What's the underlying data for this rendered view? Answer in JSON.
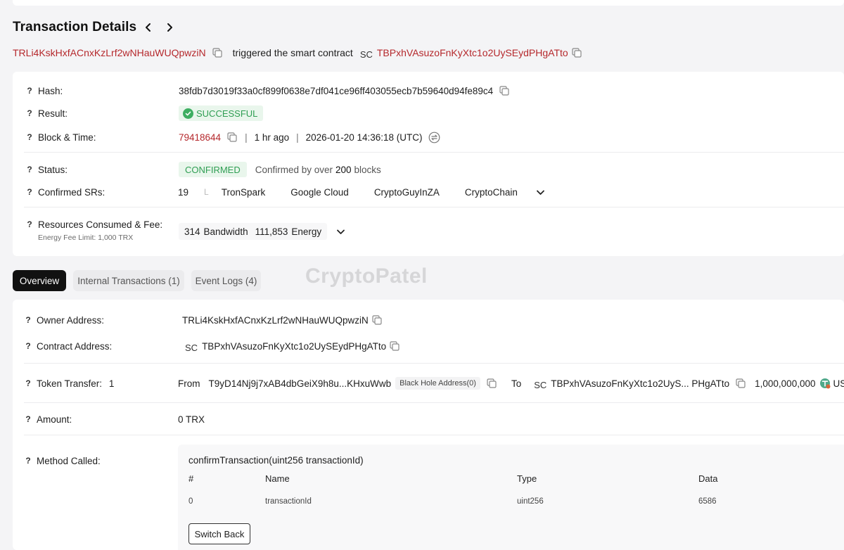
{
  "header": {
    "title": "Transaction Details"
  },
  "trigger": {
    "from_address": "TRLi4KskHxfACnxKzLrf2wNHauWUQpwziN",
    "text": "triggered the smart contract",
    "sc_tag": "SC",
    "contract_address": "TBPxhVAsuzoFnKyXtc1o2UySEydPHgATto"
  },
  "details": {
    "hash_label": "Hash:",
    "hash_value": "38fdb7d3019f33a0cf899f0638e7df041ce96ff403055ecb7b59640d94fe89c4",
    "result_label": "Result:",
    "result_value": "SUCCESSFUL",
    "block_label": "Block & Time:",
    "block_number": "79418644",
    "block_ago": "1 hr ago",
    "block_time": "2026-01-20 14:36:18 (UTC)",
    "pipe": "|",
    "status_label": "Status:",
    "status_value": "CONFIRMED",
    "status_note_prefix": "Confirmed by over",
    "status_note_count": "200",
    "status_note_suffix": "blocks",
    "srs_label": "Confirmed SRs:",
    "srs_count": "19",
    "srs_sub": "L",
    "srs_list": [
      "TronSpark",
      "Google Cloud",
      "CryptoGuyInZA",
      "CryptoChain"
    ],
    "resources_label": "Resources Consumed & Fee:",
    "resources_sub": "Energy Fee Limit: 1,000 TRX",
    "bandwidth_value": "314",
    "bandwidth_label": "Bandwidth",
    "energy_value": "111,853",
    "energy_label": "Energy"
  },
  "tabs": {
    "overview": "Overview",
    "internal": "Internal Transactions (1)",
    "events": "Event Logs (4)"
  },
  "watermark": "CryptoPatel",
  "overview": {
    "owner_label": "Owner Address:",
    "owner_value": "TRLi4KskHxfACnxKzLrf2wNHauWUQpwziN",
    "contract_label": "Contract Address:",
    "contract_sc": "SC",
    "contract_value": "TBPxhVAsuzoFnKyXtc1o2UySEydPHgATto",
    "transfer_label": "Token Transfer:",
    "transfer_count": "1",
    "from_label": "From",
    "from_address": "T9yD14Nj9j7xAB4dbGeiX9h8u...KHxuWwb",
    "from_tag": "Black Hole Address(0)",
    "to_label": "To",
    "to_sc": "SC",
    "to_address": "TBPxhVAsuzoFnKyXtc1o2UyS... PHgATto",
    "transfer_amount": "1,000,000,000",
    "transfer_token": "USDT",
    "amount_label": "Amount:",
    "amount_value": "0 TRX",
    "method_label": "Method Called:",
    "method_signature": "confirmTransaction(uint256 transactionId)",
    "method_headers": [
      "#",
      "Name",
      "Type",
      "Data"
    ],
    "method_row": [
      "0",
      "transactionId",
      "uint256",
      "6586"
    ],
    "switch_back": "Switch Back"
  },
  "colors": {
    "link_red": "#b5282c",
    "success_green": "#2f9e53",
    "success_bg": "#e9f6ec"
  },
  "icons": {
    "copy": "copy-icon",
    "check": "check-circle-icon",
    "convert": "time-convert-icon",
    "chevron": "chevron-down-icon",
    "token": "usdt-token-icon"
  }
}
